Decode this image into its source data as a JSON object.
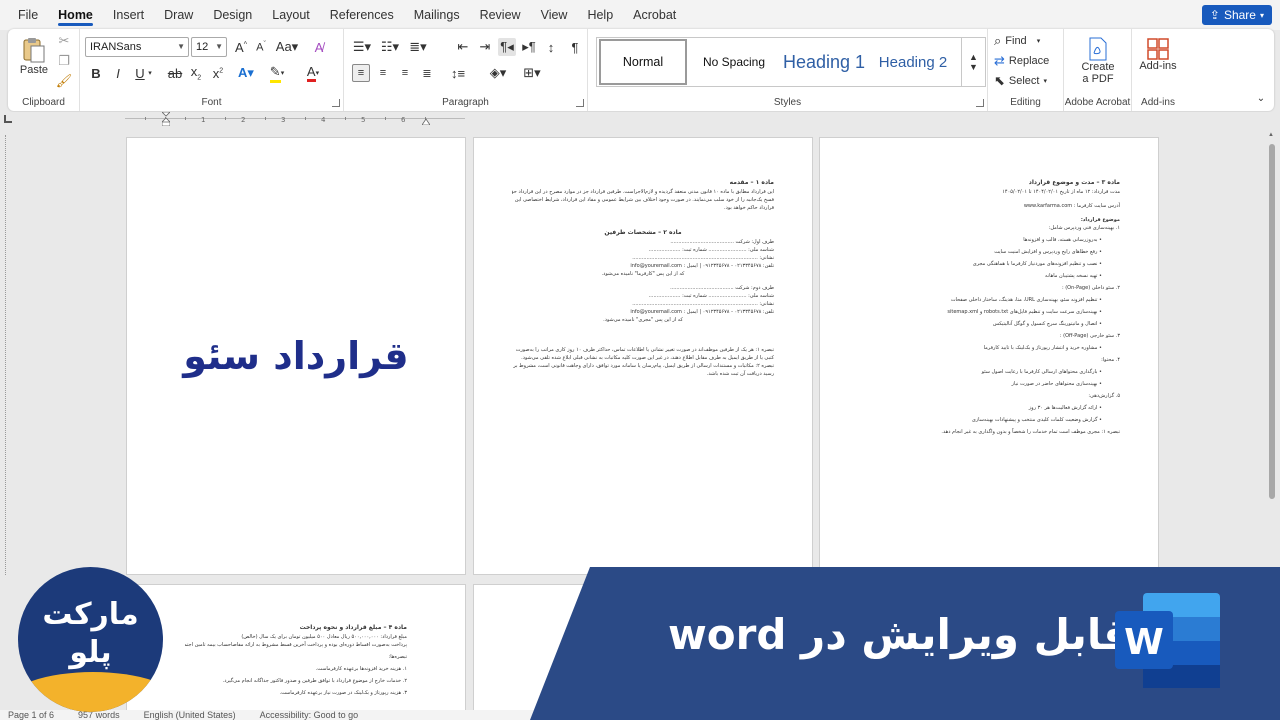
{
  "menu": {
    "tabs": [
      "File",
      "Home",
      "Insert",
      "Draw",
      "Design",
      "Layout",
      "References",
      "Mailings",
      "Review",
      "View",
      "Help",
      "Acrobat"
    ],
    "active_tab": "Home",
    "share_label": "Share"
  },
  "ribbon": {
    "clipboard": {
      "paste_label": "Paste",
      "group_label": "Clipboard"
    },
    "font": {
      "font_name": "IRANSans",
      "font_size": "12",
      "group_label": "Font"
    },
    "paragraph": {
      "group_label": "Paragraph"
    },
    "styles": {
      "items": [
        "Normal",
        "No Spacing",
        "Heading 1",
        "Heading 2"
      ],
      "selected": "Normal",
      "group_label": "Styles"
    },
    "editing": {
      "find_label": "Find",
      "replace_label": "Replace",
      "select_label": "Select",
      "group_label": "Editing"
    },
    "acrobat": {
      "create_label": "Create",
      "create_label2": "a PDF",
      "group_label": "Adobe Acrobat"
    },
    "addins": {
      "label": "Add-ins",
      "group_label": "Add-ins"
    }
  },
  "pages": {
    "cover_title": "قرارداد سئو",
    "page2": {
      "heading1": "ماده ۱ – مقدمه",
      "para1": [
        "این قرارداد مطابق با ماده ۱۰ قانون مدنی منعقد گردیده و لازم‌الاجراست. طرفین قرارداد جز در موارد مصرح در این قرارداد حق",
        "فسخ یک‌جانبه را از خود سلب می‌نمایند. در صورت وجود اختلاف بین شرایط عمومی و مفاد این قرارداد، شرایط اختصاصی این",
        "قرارداد حاکم خواهد بود."
      ],
      "heading2": "ماده ۲ – مشخصات طرفین",
      "party1": [
        "طرف اول: شرکت ........................................",
        "شناسه ملی: ........................ شماره ثبت: ....................",
        "نشانی: ...............................................................................",
        "تلفن: ۰۲۱۳۳۴۵۶۷۸ - ۰۹۱۲۳۴۵۶۷۸ | ایمیل : info@youremail.com",
        "که از این پس \"کارفرما\" نامیده می‌شود."
      ],
      "party2": [
        "طرف دوم: شرکت ........................................",
        "شناسه ملی: ........................ شماره ثبت: ....................",
        "نشانی: ...............................................................................",
        "تلفن: ۰۲۱۳۳۴۵۶۷۸ - ۰۹۱۲۳۴۵۶۷۸ | ایمیل : info@youremail.com",
        "که از این پس \"مجری\" نامیده می‌شود."
      ],
      "notes": [
        "تبصره ۱: هر یک از طرفین موظف‌اند در صورت تغییر نشانی یا اطلاعات تماس، حداکثر ظرف ۱۰ روز کاری مراتب را به‌صورت",
        "کتبی یا از طریق ایمیل به طرف مقابل اطلاع دهند، در غیر این صورت کلیه مکاتبات به نشانی قبلی ابلاغ شده تلقی می‌شود.",
        "تبصره ۲: مکاتبات و مستندات ارسالی از طریق ایمیل، پیام‌رسان یا سامانه مورد توافق، دارای وجاهت قانونی است، مشروط بر اینکه",
        "رسید دریافت آن ثبت شده باشد."
      ]
    },
    "page3": {
      "heading": "ماده ۳ – مدت و موضوع قرارداد",
      "lines": [
        "مدت قرارداد: ۱۲ ماه از تاریخ ۱۴۰۴/۰۲/۰۱ تا ۱۴۰۵/۰۲/۰۱",
        "آدرس سایت کارفرما : www.karfarma.com",
        "موضوع قرارداد:",
        "۱. بهینه‌سازی فنی وردپرس شامل:"
      ],
      "bullets1": [
        "به‌روزرسانی هسته، قالب و افزونه‌ها",
        "رفع خطاهای رایج وردپرس و افزایش امنیت سایت",
        "نصب و تنظیم افزونه‌های موردنیاز کارفرما با هماهنگی مجری",
        "تهیه نسخه پشتیبان ماهانه"
      ],
      "section2": "۲. سئو داخلی (On-Page) :",
      "bullets2": [
        "تنظیم افزونه سئو، بهینه‌سازی URL، متا، هدینگ، ساختار داخلی صفحات",
        "بهینه‌سازی سرعت سایت و تنظیم فایل‌های robots.txt و sitemap.xml",
        "اتصال و مانیتورینگ سرچ کنسول و گوگل آنالیتیکس"
      ],
      "section3": "۳. سئو خارجی (Off-Page) :",
      "bullets3": [
        "مشاوره خرید و انتشار رپورتاژ و بک‌لینک با تایید کارفرما"
      ],
      "section4": "۴. محتوا:",
      "bullets4": [
        "بارگذاری محتواهای ارسالی کارفرما با رعایت اصول سئو",
        "بهینه‌سازی محتواهای حاضر در صورت نیاز"
      ],
      "section5": "۵. گزارش‌دهی:",
      "bullets5": [
        "ارائه گزارش فعالیت‌ها هر ۳۰ روز",
        "گزارش وضعیت کلمات کلیدی منتخب و پیشنهادات بهینه‌سازی"
      ],
      "note": "تبصره ۱: مجری موظف است تمام خدمات را شخصاً و بدون واگذاری به غیر انجام دهد."
    },
    "page4": {
      "heading": "ماده ۴ – مبلغ قرارداد و نحوه پرداخت",
      "lines": [
        "مبلغ قرارداد: ۵۰۰,۰۰۰,۰۰۰ ریال معادل ۵۰۰ میلیون تومان برای یک سال (خالص)",
        "پرداخت به‌صورت اقساط دوره‌ای بوده و پرداخت آخرین قسط مشروط به ارائه مفاصاحساب بیمه تامین اجتماعی است.",
        "تبصره‌ها:",
        "۱. هزینه خرید افزونه‌ها برعهده کارفرماست.",
        "۲. خدمات خارج از موضوع قرارداد با توافق طرفین و صدور فاکتور جداگانه انجام می‌گیرد.",
        "۳. هزینه رپورتاژ و بک‌لینک در صورت نیاز برعهده کارفرماست."
      ]
    }
  },
  "statusbar": {
    "page": "Page 1 of 6",
    "words": "957 words",
    "language": "English (United States)",
    "accessibility": "Accessibility: Good to go"
  },
  "overlay": {
    "title": "قابل ویرایش در word",
    "logo_line1": "مارکت",
    "logo_line2": "پلو"
  },
  "colors": {
    "accent": "#185abd",
    "banner": "#2b4a86",
    "cover_title": "#1f2e8a",
    "logo_yellow": "#f3b22b"
  }
}
